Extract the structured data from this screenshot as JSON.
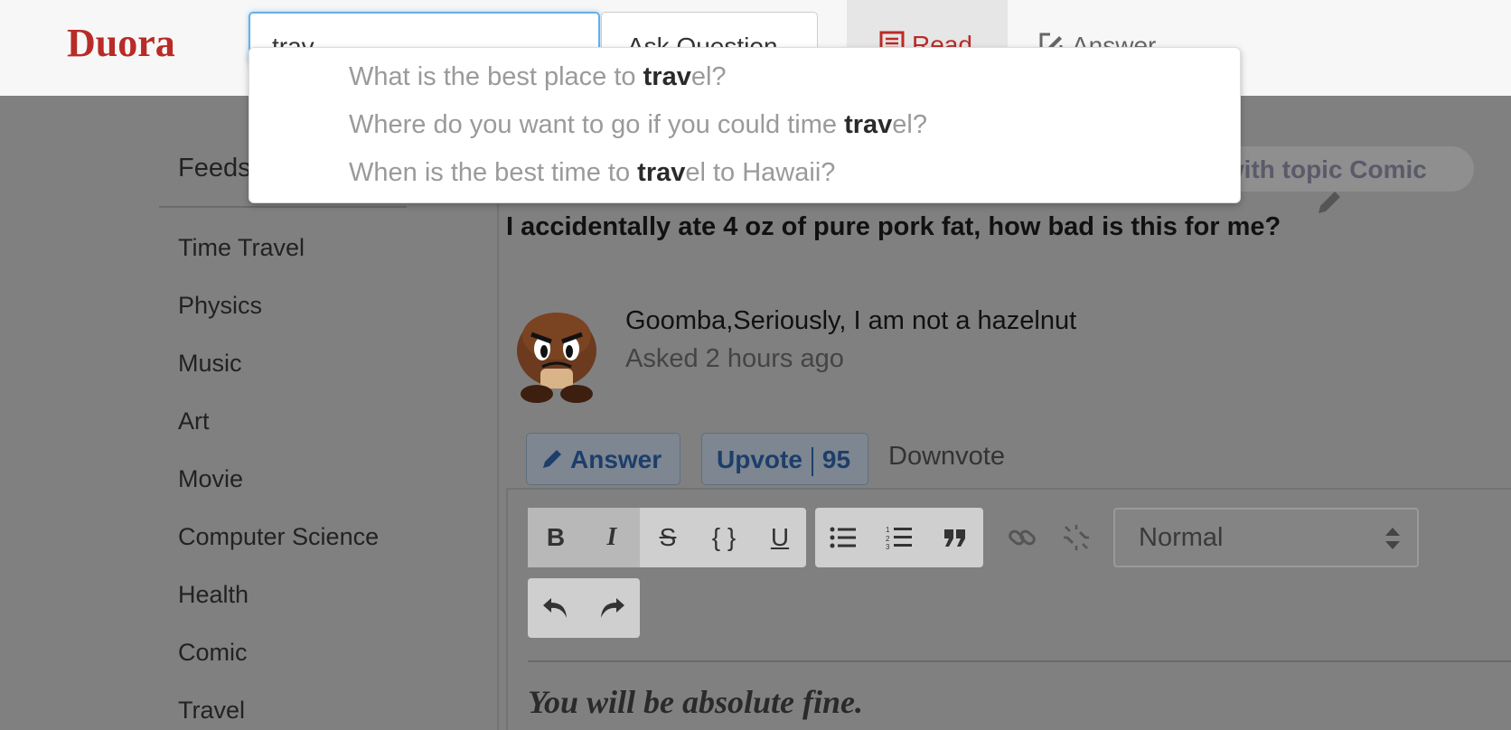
{
  "header": {
    "logo": "Duora",
    "search": {
      "value": "trav",
      "placeholder": ""
    },
    "ask_label": "Ask Question",
    "nav": {
      "read": "Read",
      "answer": "Answer"
    }
  },
  "suggestions": [
    {
      "before": "What is the best place to ",
      "match": "trav",
      "after": "el?"
    },
    {
      "before": "Where do you want to go if you could time ",
      "match": "trav",
      "after": "el?"
    },
    {
      "before": "When is the best time to ",
      "match": "trav",
      "after": "el to Hawaii?"
    }
  ],
  "sidebar": {
    "title": "Feeds",
    "items": [
      "Time Travel",
      "Physics",
      "Music",
      "Art",
      "Movie",
      "Computer Science",
      "Health",
      "Comic",
      "Travel"
    ]
  },
  "topic_pill": "d with topic Comic",
  "question": {
    "title": "I accidentally ate 4 oz of pure pork fat, how bad is this for me?",
    "author": "Goomba,Seriously, I am not a hazelnut",
    "asked": "Asked 2 hours ago"
  },
  "actions": {
    "answer": "Answer",
    "upvote": "Upvote",
    "upvote_count": "95",
    "downvote": "Downvote"
  },
  "editor": {
    "format_value": "Normal",
    "content": "You will be absolute fine."
  },
  "colors": {
    "brand": "#b92b27",
    "focus": "#66afe9"
  }
}
